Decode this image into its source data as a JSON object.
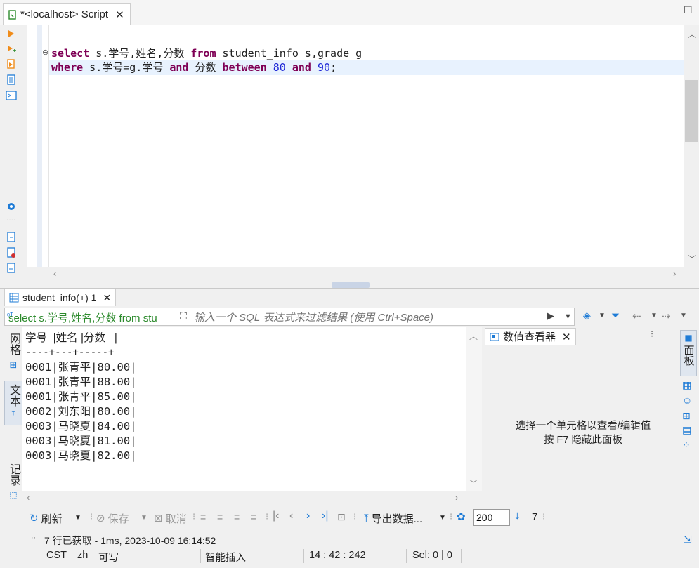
{
  "editor_tab": {
    "title": "*<localhost> Script"
  },
  "sql": {
    "line1": {
      "kw1": "select",
      "rest1": " s.学号,姓名,分数 ",
      "kw2": "from",
      "rest2": " student_info s,grade g"
    },
    "line2": {
      "kw1": "where",
      "rest1": " s.学号=g.学号 ",
      "kw2": "and",
      "rest2": " 分数 ",
      "kw3": "between",
      "n1": "80",
      "kw4": "and",
      "n2": "90",
      "end": ";"
    }
  },
  "results": {
    "tab_label": "student_info(+) 1",
    "filter_query": "select s.学号,姓名,分数 from stu",
    "filter_placeholder": "输入一个 SQL 表达式来过滤结果 (使用 Ctrl+Space)",
    "side_tabs": {
      "grid": "网格",
      "text": "文本",
      "record": "记录"
    },
    "text_lines": [
      "学号  |姓名 |分数   |",
      "----+---+-----+",
      "0001|张青平|80.00|",
      "0001|张青平|88.00|",
      "0001|张青平|85.00|",
      "0002|刘东阳|80.00|",
      "0003|马晓夏|84.00|",
      "0003|马晓夏|81.00|",
      "0003|马晓夏|82.00|"
    ]
  },
  "value_panel": {
    "tab_label": "数值查看器",
    "message_line1": "选择一个单元格以查看/编辑值",
    "message_line2": "按 F7 隐藏此面板",
    "side_label": "面板"
  },
  "toolbar": {
    "refresh": "刷新",
    "save": "保存",
    "cancel": "取消",
    "export": "导出数据...",
    "fetch_size": "200",
    "row_count": "7"
  },
  "status": {
    "fetch_message": "7 行已获取 - 1ms, 2023-10-09 16:14:52",
    "timezone": "CST",
    "locale": "zh",
    "writable": "可写",
    "insert_mode": "智能插入",
    "cursor_pos": "14 : 42 : 242",
    "selection": "Sel: 0 | 0"
  },
  "colors": {
    "keyword": "#7f0055",
    "number": "#1f28d6",
    "filter_query": "#2c8a2c",
    "accent": "#1e7bd6"
  }
}
